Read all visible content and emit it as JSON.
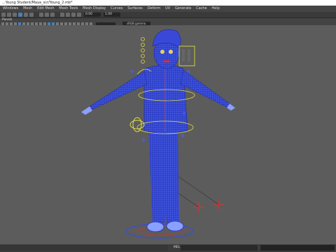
{
  "window": {
    "title": "...Young Student/Maya_scr/Young_2.mb*"
  },
  "menu": [
    "Windows",
    "Mesh",
    "Edit Mesh",
    "Mesh Tools",
    "Mesh Display",
    "Curves",
    "Surfaces",
    "Deform",
    "UV",
    "Generate",
    "Cache",
    "Help"
  ],
  "toolbar": {
    "field1": "0.00",
    "field2": "1.00",
    "colorspace": "sRGB gamma"
  },
  "viewport": {
    "panel_label": "Panels"
  },
  "statusbar": {
    "mel_label": "MEL"
  },
  "colors": {
    "mesh": "#2f3fc8",
    "wire": "#5a78ff",
    "controls": "#e8e040",
    "locators": "#e03030"
  }
}
